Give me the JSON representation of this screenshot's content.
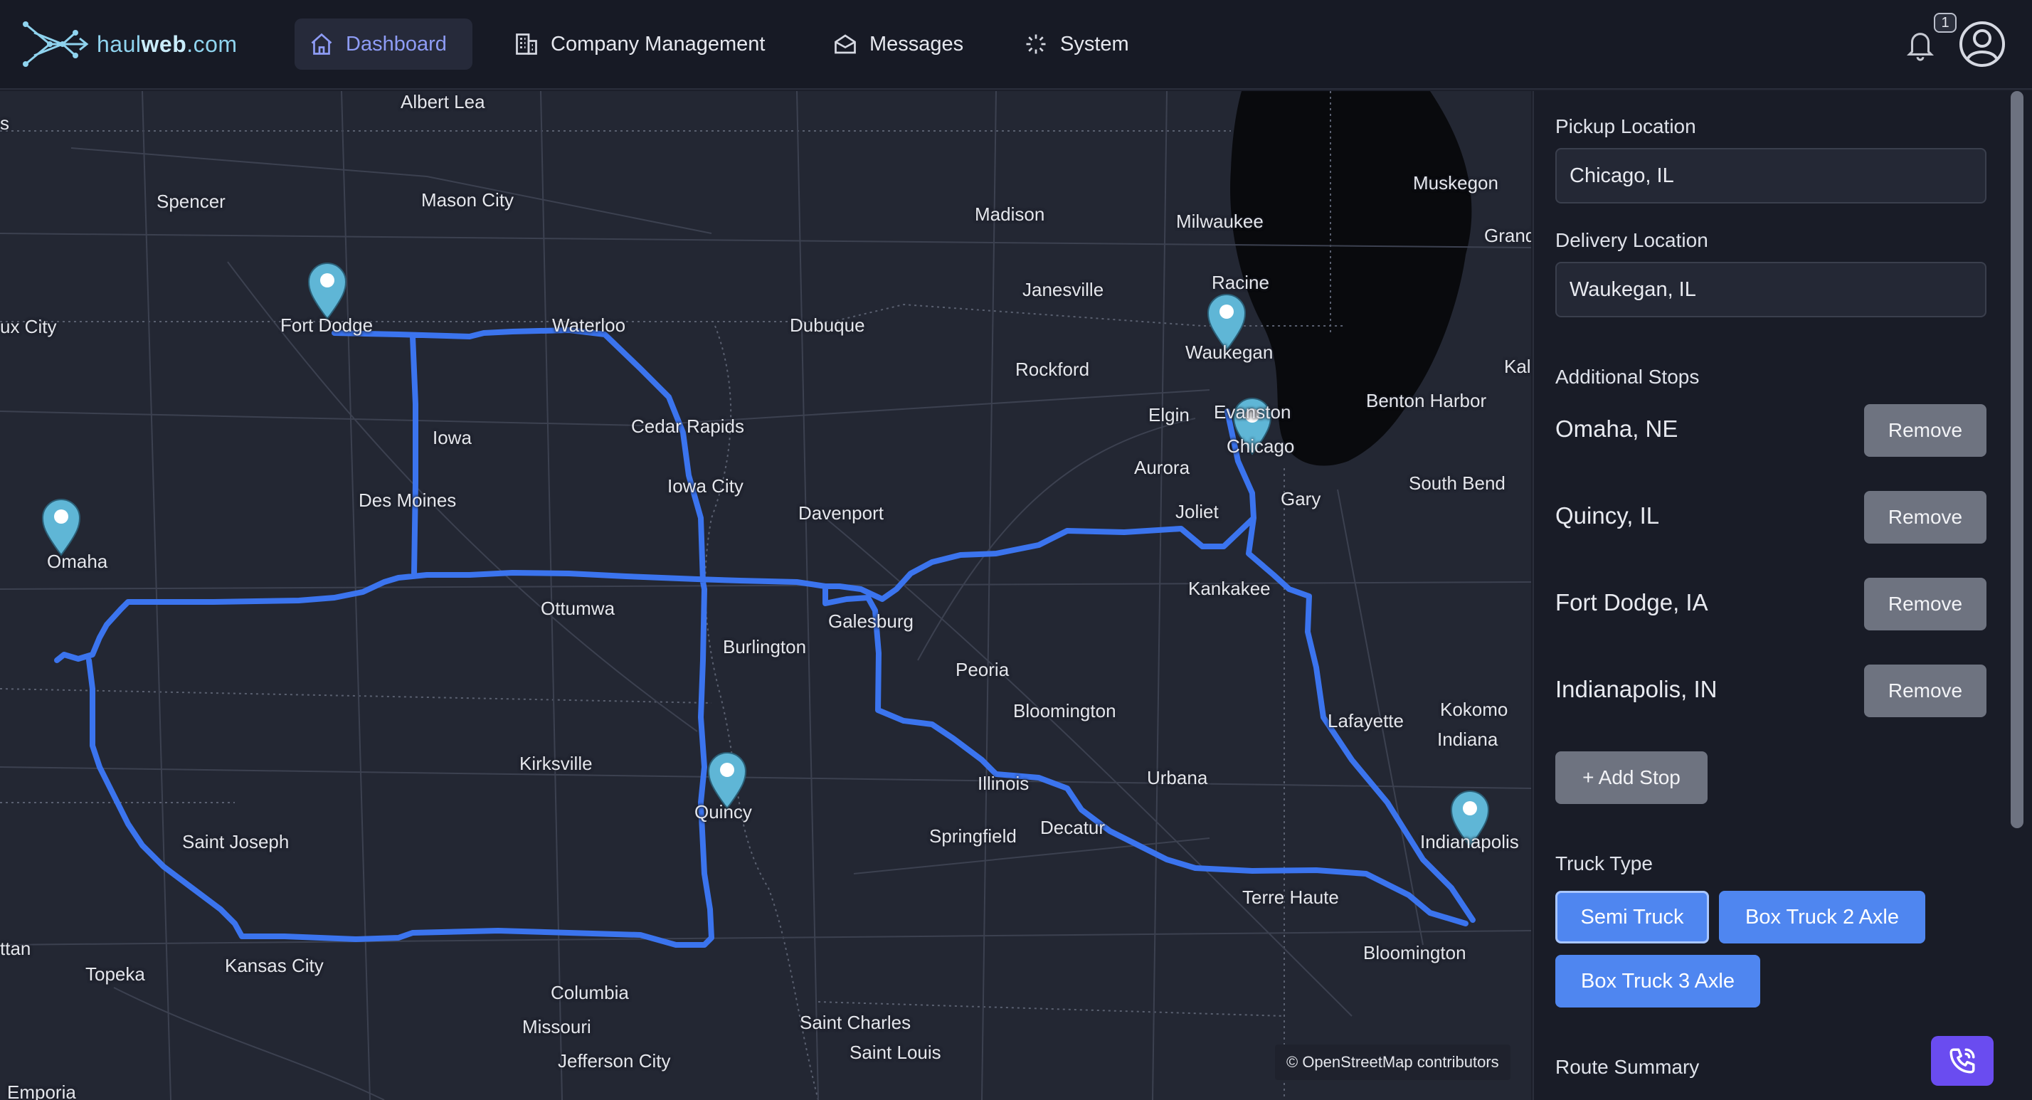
{
  "brand": {
    "name_prefix": "haul",
    "name_bold": "web",
    "name_suffix": ".com"
  },
  "nav": {
    "dashboard": "Dashboard",
    "company": "Company Management",
    "messages": "Messages",
    "system": "System"
  },
  "notifications": {
    "count": "1"
  },
  "map": {
    "attribution": "© OpenStreetMap contributors",
    "cities": [
      "Albert Lea",
      "Spencer",
      "Mason City",
      "Fort Dodge",
      "Waterloo",
      "Dubuque",
      "Madison",
      "Milwaukee",
      "Muskegon",
      "Grand",
      "Janesville",
      "Racine",
      "Waukegan",
      "Rockford",
      "Elgin",
      "Evanston",
      "Chicago",
      "Benton Harbor",
      "Kal",
      "Aurora",
      "Gary",
      "South Bend",
      "Joliet",
      "Iowa",
      "Cedar Rapids",
      "Des Moines",
      "Iowa City",
      "Davenport",
      "Omaha",
      "ux City",
      "Ottumwa",
      "Galesburg",
      "Burlington",
      "Kankakee",
      "Peoria",
      "Bloomington",
      "Lafayette",
      "Kokomo",
      "Indiana",
      "Kirksville",
      "Quincy",
      "Illinois",
      "Urbana",
      "Indianapolis",
      "Saint Joseph",
      "Springfield",
      "Decatur",
      "Terre Haute",
      "ttan",
      "Topeka",
      "Kansas City",
      "Columbia",
      "Missouri",
      "Saint Charles",
      "Saint Louis",
      "Jefferson City",
      "Bloomington",
      "Emporia",
      "s"
    ]
  },
  "form": {
    "pickup_label": "Pickup Location",
    "pickup_value": "Chicago, IL",
    "delivery_label": "Delivery Location",
    "delivery_value": "Waukegan, IL",
    "stops_label": "Additional Stops",
    "stops": [
      {
        "name": "Omaha, NE",
        "action": "Remove"
      },
      {
        "name": "Quincy, IL",
        "action": "Remove"
      },
      {
        "name": "Fort Dodge, IA",
        "action": "Remove"
      },
      {
        "name": "Indianapolis, IN",
        "action": "Remove"
      }
    ],
    "add_stop": "+ Add Stop",
    "truck_type_label": "Truck Type",
    "truck_types": [
      "Semi Truck",
      "Box Truck 2 Axle",
      "Box Truck 3 Axle"
    ],
    "selected_truck": "Semi Truck",
    "route_summary_label": "Route Summary"
  },
  "colors": {
    "route": "#3b74ee",
    "pin": "#5fb6d6",
    "accent": "#4f86f0",
    "nav_active": "#8e9cf5",
    "call_button": "#6a4cf0"
  },
  "icons": [
    "logo-network-icon",
    "home-icon",
    "building-icon",
    "envelope-icon",
    "sparkle-icon",
    "bell-icon",
    "user-icon",
    "phone-icon",
    "map-pin-icon"
  ]
}
